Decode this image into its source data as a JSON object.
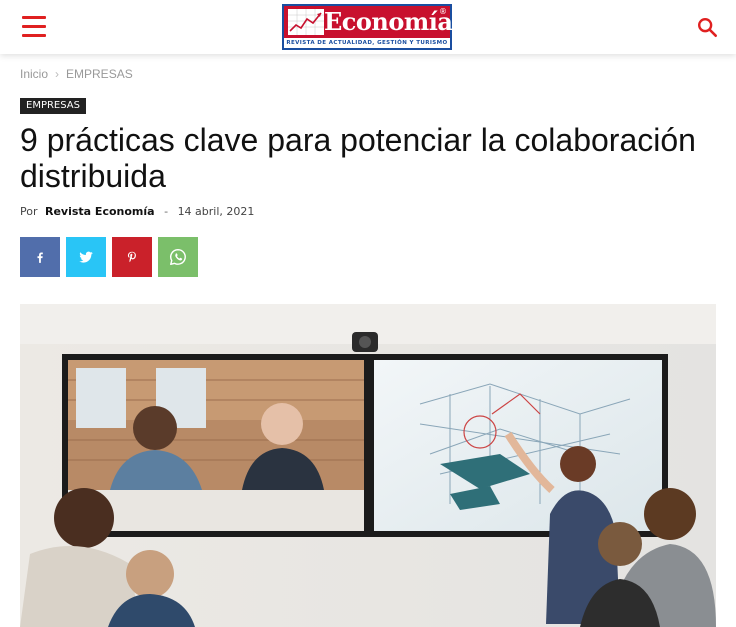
{
  "header": {
    "menu_icon": "hamburger-icon",
    "logo": {
      "title": "Economía",
      "registered": "®",
      "tagline": "REVISTA DE ACTUALIDAD, GESTIÓN Y TURISMO"
    },
    "search_icon": "search-icon",
    "colors": {
      "accent": "#e02020",
      "logo_red": "#c8102e",
      "logo_blue": "#1a4ea0"
    }
  },
  "breadcrumb": {
    "home": "Inicio",
    "separator": "›",
    "current": "EMPRESAS"
  },
  "article": {
    "category": "EMPRESAS",
    "title": "9 prácticas clave para potenciar la colaboración distribuida",
    "by_label": "Por",
    "author": "Revista Economía",
    "dash": "-",
    "date": "14 abril, 2021"
  },
  "share": [
    {
      "network": "facebook",
      "icon": "facebook-icon",
      "color": "#516eab"
    },
    {
      "network": "twitter",
      "icon": "twitter-icon",
      "color": "#29c5f6"
    },
    {
      "network": "pinterest",
      "icon": "pinterest-icon",
      "color": "#ca212a"
    },
    {
      "network": "whatsapp",
      "icon": "whatsapp-icon",
      "color": "#7bbf6a"
    }
  ]
}
